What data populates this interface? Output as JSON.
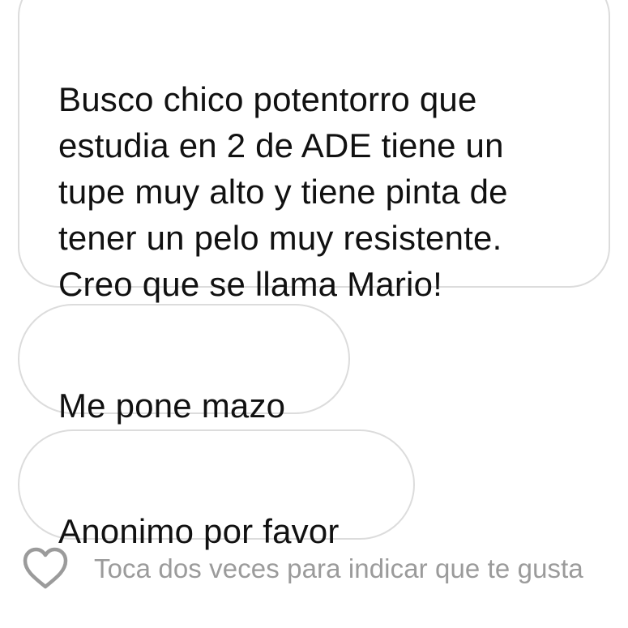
{
  "messages": [
    {
      "text": "Busco chico potentorro que\nestudia en 2 de ADE  tiene un\ntupe muy alto y tiene pinta de\ntener un pelo muy resistente.\nCreo que se llama Mario!"
    },
    {
      "text": "Me pone mazo"
    },
    {
      "text": "Anonimo por favor"
    }
  ],
  "like_bar": {
    "icon": "heart-outline-icon",
    "hint": "Toca dos veces para indicar que te gusta"
  },
  "colors": {
    "bubble_border": "#dcdcdc",
    "message_text": "#111111",
    "hint_text": "#9b9b9b",
    "heart_stroke": "#9b9b9b"
  }
}
